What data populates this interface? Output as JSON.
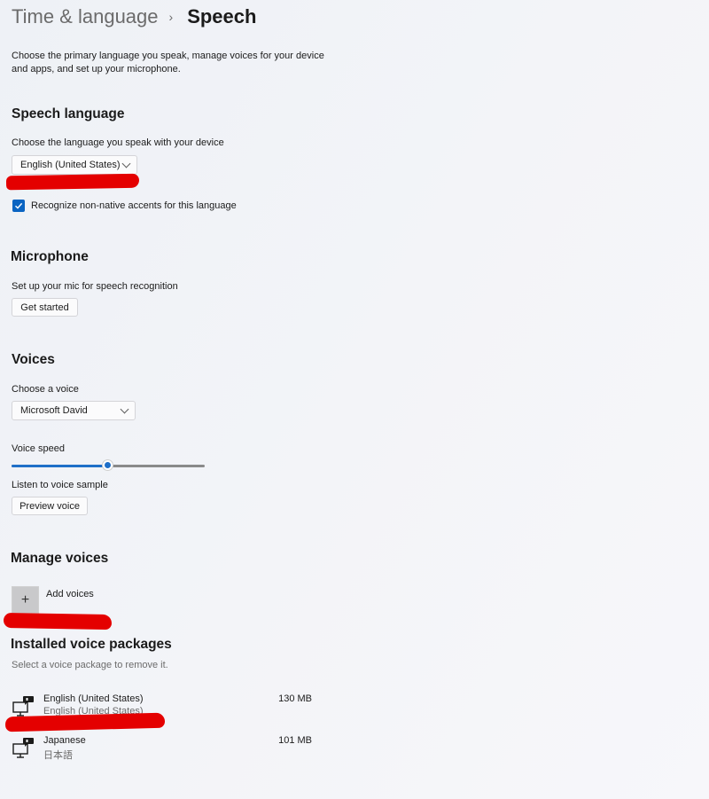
{
  "breadcrumb": {
    "parent": "Time & language",
    "separator": "›",
    "current": "Speech"
  },
  "description": "Choose the primary language you speak, manage voices for your device and apps, and set up your microphone.",
  "speech_language": {
    "heading": "Speech language",
    "prompt": "Choose the language you speak with your device",
    "selected": "English (United States)",
    "checkbox_label": "Recognize non-native accents for this language",
    "checkbox_checked": true
  },
  "microphone": {
    "heading": "Microphone",
    "prompt": "Set up your mic for speech recognition",
    "button": "Get started"
  },
  "voices": {
    "heading": "Voices",
    "prompt": "Choose a voice",
    "selected": "Microsoft David",
    "speed_label": "Voice speed",
    "speed_value": 0.5,
    "sample_label": "Listen to voice sample",
    "preview_button": "Preview voice"
  },
  "manage_voices": {
    "heading": "Manage voices",
    "add_label": "Add voices",
    "add_icon": "+"
  },
  "installed": {
    "heading": "Installed voice packages",
    "hint": "Select a voice package to remove it.",
    "packages": [
      {
        "name": "English (United States)",
        "subtitle": "English (United States)",
        "size": "130 MB",
        "icon": "speech-pc-icon"
      },
      {
        "name": "Japanese",
        "subtitle": "日本語",
        "size": "101 MB",
        "icon": "speech-pc-icon"
      }
    ]
  },
  "colors": {
    "accent": "#0a64c2",
    "redaction": "#e40000"
  }
}
